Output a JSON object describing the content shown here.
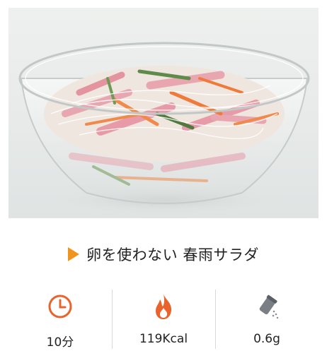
{
  "recipe": {
    "image_alt": "",
    "title": "卵を使わない 春雨サラダ"
  },
  "stats": {
    "time": {
      "icon": "clock-icon",
      "value": "10分"
    },
    "calories": {
      "icon": "flame-icon",
      "value": "119Kcal"
    },
    "salt": {
      "icon": "salt-shaker-icon",
      "value": "0.6g"
    }
  },
  "colors": {
    "accent": "#f0941e",
    "icon_orange": "#e8642c",
    "divider": "#d9d9d9"
  }
}
